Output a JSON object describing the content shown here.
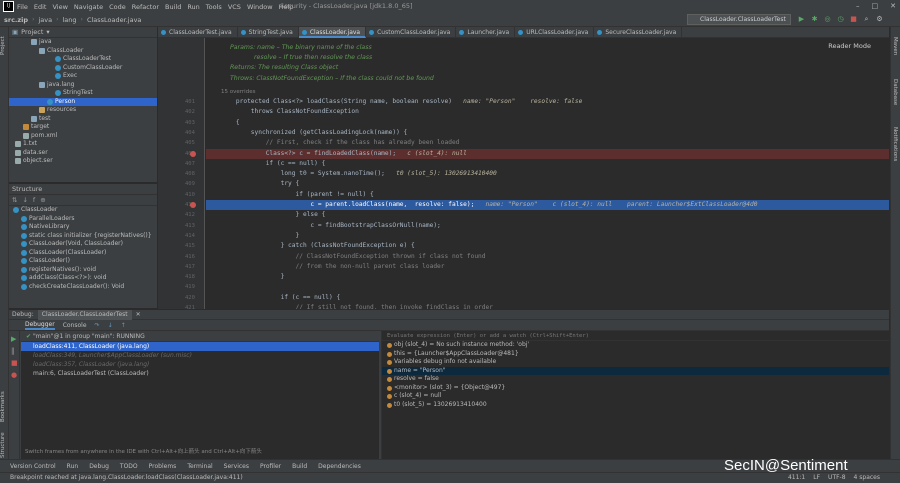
{
  "menu": [
    "File",
    "Edit",
    "View",
    "Navigate",
    "Code",
    "Refactor",
    "Build",
    "Run",
    "Tools",
    "VCS",
    "Window",
    "Help"
  ],
  "window_title": "Security - ClassLoader.java [jdk1.8.0_65]",
  "breadcrumbs": [
    "src.zip",
    "java",
    "lang",
    "ClassLoader.java"
  ],
  "run_config": "ClassLoader.ClassLoaderTest",
  "project": {
    "title": "Project",
    "rows": [
      {
        "label": "java",
        "type": "fold",
        "indent": 30
      },
      {
        "label": "ClassLoader",
        "type": "fold",
        "indent": 38
      },
      {
        "label": "ClassLoaderTest",
        "type": "cls",
        "indent": 54
      },
      {
        "label": "CustomClassLoader",
        "type": "cls",
        "indent": 54
      },
      {
        "label": "Exec",
        "type": "cls",
        "indent": 54
      },
      {
        "label": "java.lang",
        "type": "fold",
        "indent": 38
      },
      {
        "label": "StringTest",
        "type": "cls",
        "indent": 54
      },
      {
        "label": "Person",
        "type": "cls",
        "indent": 46,
        "selected": true
      },
      {
        "label": "resources",
        "type": "res",
        "indent": 38
      },
      {
        "label": "test",
        "type": "fold",
        "indent": 30
      },
      {
        "label": "target",
        "type": "tgt",
        "indent": 22
      },
      {
        "label": "pom.xml",
        "type": "file",
        "indent": 22
      },
      {
        "label": "1.txt",
        "type": "file",
        "indent": 14
      },
      {
        "label": "data.ser",
        "type": "file",
        "indent": 14
      },
      {
        "label": "object.ser",
        "type": "file",
        "indent": 14
      }
    ]
  },
  "structure": {
    "title": "Structure",
    "rows": [
      "ClassLoader",
      "ParallelLoaders",
      "NativeLibrary",
      "static class initializer {registerNatives()}",
      "ClassLoader(Void, ClassLoader)",
      "ClassLoader(ClassLoader)",
      "ClassLoader()",
      "registerNatives(): void",
      "addClass(Class<?>): void",
      "checkCreateClassLoader(): Void"
    ]
  },
  "tabs": [
    "ClassLoaderTest.java",
    "StringTest.java",
    "ClassLoader.java",
    "CustomClassLoader.java",
    "Launcher.java",
    "URLClassLoader.java",
    "SecureClassLoader.java"
  ],
  "active_tab": 2,
  "reader_mode": "Reader Mode",
  "doc": {
    "p1": "Params: name – The binary name of the class",
    "p2": "resolve – If true then resolve the class",
    "ret": "Returns: The resulting Class object",
    "thr": "Throws: ClassNotFoundException – If the class could not be found",
    "overrides": "15 overrides"
  },
  "lines": [
    {
      "n": "401",
      "t": "    protected Class<?> loadClass(String name, boolean resolve)",
      "h": "   name: \"Person\"    resolve: false"
    },
    {
      "n": "402",
      "t": "        throws ClassNotFoundException",
      "h": ""
    },
    {
      "n": "403",
      "t": "    {",
      "h": ""
    },
    {
      "n": "404",
      "t": "        synchronized (getClassLoadingLock(name)) {",
      "h": ""
    },
    {
      "n": "405",
      "t": "            // First, check if the class has already been loaded",
      "h": ""
    },
    {
      "n": "406",
      "t": "            Class<?> c = findLoadedClass(name);",
      "h": "   c (slot_4): null",
      "err": true
    },
    {
      "n": "407",
      "t": "            if (c == null) {",
      "h": ""
    },
    {
      "n": "408",
      "t": "                long t0 = System.nanoTime();",
      "h": "   t0 (slot_5): 13026913410400"
    },
    {
      "n": "409",
      "t": "                try {",
      "h": ""
    },
    {
      "n": "410",
      "t": "                    if (parent != null) {",
      "h": ""
    },
    {
      "n": "411",
      "t": "                        c = parent.loadClass(name,  resolve: false);",
      "h": "   name: \"Person\"    c (slot_4): null    parent: Launcher$ExtClassLoader@4d0",
      "cur": true
    },
    {
      "n": "412",
      "t": "                    } else {",
      "h": ""
    },
    {
      "n": "413",
      "t": "                        c = findBootstrapClassOrNull(name);",
      "h": ""
    },
    {
      "n": "414",
      "t": "                    }",
      "h": ""
    },
    {
      "n": "415",
      "t": "                } catch (ClassNotFoundException e) {",
      "h": ""
    },
    {
      "n": "416",
      "t": "                    // ClassNotFoundException thrown if class not found",
      "h": ""
    },
    {
      "n": "417",
      "t": "                    // from the non-null parent class loader",
      "h": ""
    },
    {
      "n": "418",
      "t": "                }",
      "h": ""
    },
    {
      "n": "419",
      "t": "",
      "h": ""
    },
    {
      "n": "420",
      "t": "                if (c == null) {",
      "h": ""
    },
    {
      "n": "421",
      "t": "                    // If still not found, then invoke findClass in order",
      "h": ""
    }
  ],
  "debug": {
    "label": "Debug:",
    "config_tab": "ClassLoader.ClassLoaderTest",
    "tabs": [
      "Debugger",
      "Console"
    ],
    "thread": "\"main\"@1 in group \"main\": RUNNING",
    "frames": [
      {
        "t": "loadClass:411, ClassLoader (java.lang)",
        "sel": true
      },
      {
        "t": "loadClass:349, Launcher$AppClassLoader (sun.misc)",
        "dim": true
      },
      {
        "t": "loadClass:357, ClassLoader (java.lang)",
        "dim": true
      },
      {
        "t": "main:6, ClassLoaderTest (ClassLoader)"
      }
    ],
    "frames_hint": "Switch frames from anywhere in the IDE with Ctrl+Alt+向上箭头 and Ctrl+Alt+向下箭头",
    "eval_placeholder": "Evaluate expression (Enter) or add a watch (Ctrl+Shift+Enter)",
    "vars": [
      {
        "t": "obj (slot_4) = No such instance method: 'obj'"
      },
      {
        "t": "this = {Launcher$AppClassLoader@481}",
        "exp": true
      },
      {
        "t": "Variables debug info not available"
      },
      {
        "t": "name = \"Person\"",
        "exp": true,
        "sel": true
      },
      {
        "t": "resolve = false"
      },
      {
        "t": "<monitor> (slot_3) = {Object@497}",
        "exp": true
      },
      {
        "t": "c (slot_4) = null"
      },
      {
        "t": "t0 (slot_5) = 13026913410400"
      }
    ]
  },
  "bottom_tabs": [
    "Version Control",
    "Run",
    "Debug",
    "TODO",
    "Problems",
    "Terminal",
    "Services",
    "Profiler",
    "Build",
    "Dependencies"
  ],
  "status": {
    "left": "Breakpoint reached at java.lang.ClassLoader.loadClass(ClassLoader.java:411)",
    "pos": "411:1",
    "lf": "LF",
    "enc": "UTF-8",
    "indent": "4 spaces"
  },
  "watermark": "SecIN@Sentiment"
}
